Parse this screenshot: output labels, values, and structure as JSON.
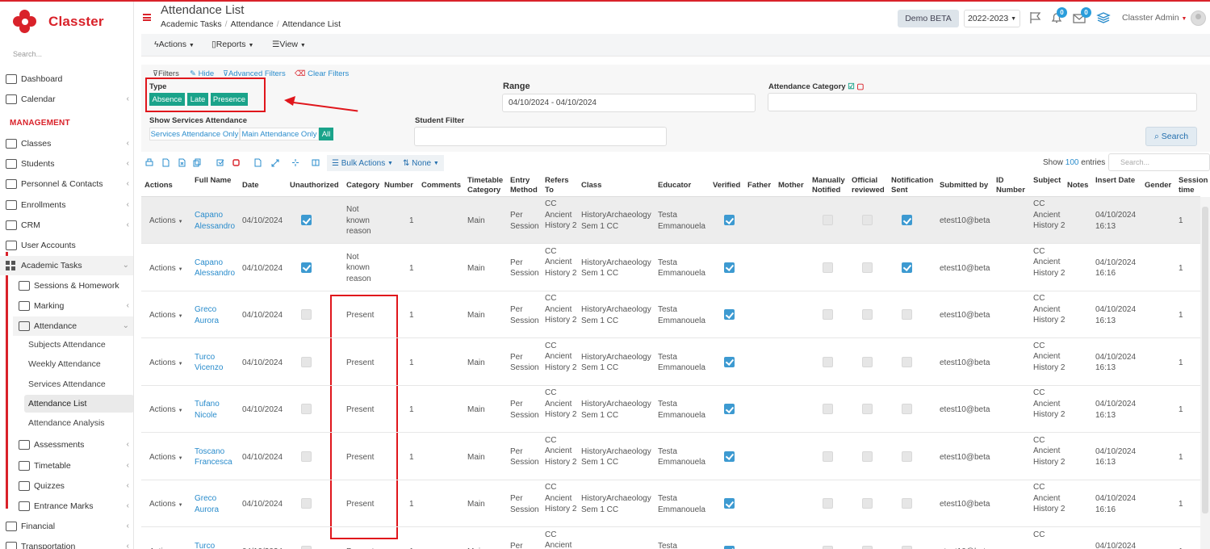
{
  "brand": {
    "name": "Classter"
  },
  "sidebar": {
    "search_placeholder": "Search...",
    "section_management": "MANAGEMENT",
    "items": [
      {
        "label": "Dashboard",
        "icon": "monitor-icon"
      },
      {
        "label": "Calendar",
        "icon": "calendar-icon"
      },
      {
        "label": "Classes",
        "icon": "classes-icon"
      },
      {
        "label": "Students",
        "icon": "students-icon"
      },
      {
        "label": "Personnel & Contacts",
        "icon": "personnel-icon"
      },
      {
        "label": "Enrollments",
        "icon": "enrollments-icon"
      },
      {
        "label": "CRM",
        "icon": "crm-icon"
      },
      {
        "label": "User Accounts",
        "icon": "key-icon"
      },
      {
        "label": "Academic Tasks",
        "icon": "grid-icon"
      },
      {
        "label": "Sessions & Homework",
        "icon": "sessions-icon"
      },
      {
        "label": "Marking",
        "icon": "marking-icon"
      },
      {
        "label": "Attendance",
        "icon": "attendance-icon"
      },
      {
        "label": "Assessments",
        "icon": "assessments-icon"
      },
      {
        "label": "Timetable",
        "icon": "timetable-icon"
      },
      {
        "label": "Quizzes",
        "icon": "quizzes-icon"
      },
      {
        "label": "Entrance Marks",
        "icon": "entrance-icon"
      },
      {
        "label": "Financial",
        "icon": "financial-icon"
      },
      {
        "label": "Transportation",
        "icon": "transportation-icon"
      }
    ],
    "attendance_sub": [
      "Subjects Attendance",
      "Weekly Attendance",
      "Services Attendance",
      "Attendance List",
      "Attendance Analysis"
    ]
  },
  "header": {
    "title": "Attendance List",
    "breadcrumb": [
      "Academic Tasks",
      "Attendance",
      "Attendance List"
    ],
    "demo_label": "Demo BETA",
    "year_label": "2022-2023",
    "notifications_count": "0",
    "messages_count": "0",
    "user_label": "Classter Admin"
  },
  "toolbar": {
    "actions": "Actions",
    "reports": "Reports",
    "view": "View"
  },
  "filters": {
    "filters_label": "Filters",
    "hide_label": "Hide",
    "advanced_label": "Advanced Filters",
    "clear_label": "Clear Filters",
    "type_label": "Type",
    "type_chips": [
      "Absence",
      "Late",
      "Presence"
    ],
    "range_label": "Range",
    "range_value": "04/10/2024 - 04/10/2024",
    "category_label": "Attendance Category",
    "services_label": "Show Services Attendance",
    "services_options": [
      "Services Attendance Only",
      "Main Attendance Only",
      "All"
    ],
    "student_filter_label": "Student Filter",
    "search_button": "Search"
  },
  "table_controls": {
    "bulk_actions": "Bulk Actions",
    "none_label": "None",
    "show_label": "Show",
    "entries_count": "100",
    "entries_label": "entries",
    "search_placeholder": "Search..."
  },
  "table": {
    "columns": [
      "Actions",
      "Full Name",
      "Date",
      "Unauthorized",
      "Category",
      "Number",
      "Comments",
      "Timetable Category",
      "Entry Method",
      "Refers To",
      "Class",
      "Educator",
      "Verified",
      "Father",
      "Mother",
      "Manually Notified",
      "Official reviewed",
      "Notification Sent",
      "Submitted by",
      "ID Number",
      "Subject",
      "Notes",
      "Insert Date",
      "Gender",
      "Session time"
    ],
    "rows": [
      {
        "actions": "Actions",
        "name": "Capano Alessandro",
        "date": "04/10/2024",
        "unauthorized": true,
        "category": "Not known reason",
        "number": "1",
        "timetable": "Main",
        "entry": "Per Session",
        "refers": "CC Ancient History 2",
        "class": "HistoryArchaeology Sem 1 CC",
        "educator": "Testa Emmanouela",
        "verified": true,
        "notification_sent": true,
        "submitted": "etest10@beta",
        "subject": "CC Ancient History 2",
        "insert": "04/10/2024 16:13",
        "session": "1"
      },
      {
        "actions": "Actions",
        "name": "Capano Alessandro",
        "date": "04/10/2024",
        "unauthorized": true,
        "category": "Not known reason",
        "number": "1",
        "timetable": "Main",
        "entry": "Per Session",
        "refers": "CC Ancient History 2",
        "class": "HistoryArchaeology Sem 1 CC",
        "educator": "Testa Emmanouela",
        "verified": true,
        "notification_sent": true,
        "submitted": "etest10@beta",
        "subject": "CC Ancient History 2",
        "insert": "04/10/2024 16:16",
        "session": "1"
      },
      {
        "actions": "Actions",
        "name": "Greco Aurora",
        "date": "04/10/2024",
        "unauthorized": false,
        "category": "Present",
        "number": "1",
        "timetable": "Main",
        "entry": "Per Session",
        "refers": "CC Ancient History 2",
        "class": "HistoryArchaeology Sem 1 CC",
        "educator": "Testa Emmanouela",
        "verified": true,
        "notification_sent": false,
        "submitted": "etest10@beta",
        "subject": "CC Ancient History 2",
        "insert": "04/10/2024 16:13",
        "session": "1"
      },
      {
        "actions": "Actions",
        "name": "Turco Vicenzo",
        "date": "04/10/2024",
        "unauthorized": false,
        "category": "Present",
        "number": "1",
        "timetable": "Main",
        "entry": "Per Session",
        "refers": "CC Ancient History 2",
        "class": "HistoryArchaeology Sem 1 CC",
        "educator": "Testa Emmanouela",
        "verified": true,
        "notification_sent": false,
        "submitted": "etest10@beta",
        "subject": "CC Ancient History 2",
        "insert": "04/10/2024 16:13",
        "session": "1"
      },
      {
        "actions": "Actions",
        "name": "Tufano Nicole",
        "date": "04/10/2024",
        "unauthorized": false,
        "category": "Present",
        "number": "1",
        "timetable": "Main",
        "entry": "Per Session",
        "refers": "CC Ancient History 2",
        "class": "HistoryArchaeology Sem 1 CC",
        "educator": "Testa Emmanouela",
        "verified": true,
        "notification_sent": false,
        "submitted": "etest10@beta",
        "subject": "CC Ancient History 2",
        "insert": "04/10/2024 16:13",
        "session": "1"
      },
      {
        "actions": "Actions",
        "name": "Toscano Francesca",
        "date": "04/10/2024",
        "unauthorized": false,
        "category": "Present",
        "number": "1",
        "timetable": "Main",
        "entry": "Per Session",
        "refers": "CC Ancient History 2",
        "class": "HistoryArchaeology Sem 1 CC",
        "educator": "Testa Emmanouela",
        "verified": true,
        "notification_sent": false,
        "submitted": "etest10@beta",
        "subject": "CC Ancient History 2",
        "insert": "04/10/2024 16:13",
        "session": "1"
      },
      {
        "actions": "Actions",
        "name": "Greco Aurora",
        "date": "04/10/2024",
        "unauthorized": false,
        "category": "Present",
        "number": "1",
        "timetable": "Main",
        "entry": "Per Session",
        "refers": "CC Ancient History 2",
        "class": "HistoryArchaeology Sem 1 CC",
        "educator": "Testa Emmanouela",
        "verified": true,
        "notification_sent": false,
        "submitted": "etest10@beta",
        "subject": "CC Ancient History 2",
        "insert": "04/10/2024 16:16",
        "session": "1"
      },
      {
        "actions": "Actions",
        "name": "Turco",
        "date": "04/10/2024",
        "unauthorized": false,
        "category": "Present",
        "number": "1",
        "timetable": "Main",
        "entry": "Per",
        "refers": "CC Ancient",
        "class": "",
        "educator": "Testa",
        "verified": true,
        "notification_sent": false,
        "submitted": "etest10@beta",
        "subject": "CC",
        "insert": "04/10/2024",
        "session": "1"
      }
    ]
  },
  "colors": {
    "brand_red": "#d9222a",
    "chip_green": "#1aa38a",
    "link_blue": "#2a8ccc",
    "checkbox_blue": "#3d9ad1"
  }
}
